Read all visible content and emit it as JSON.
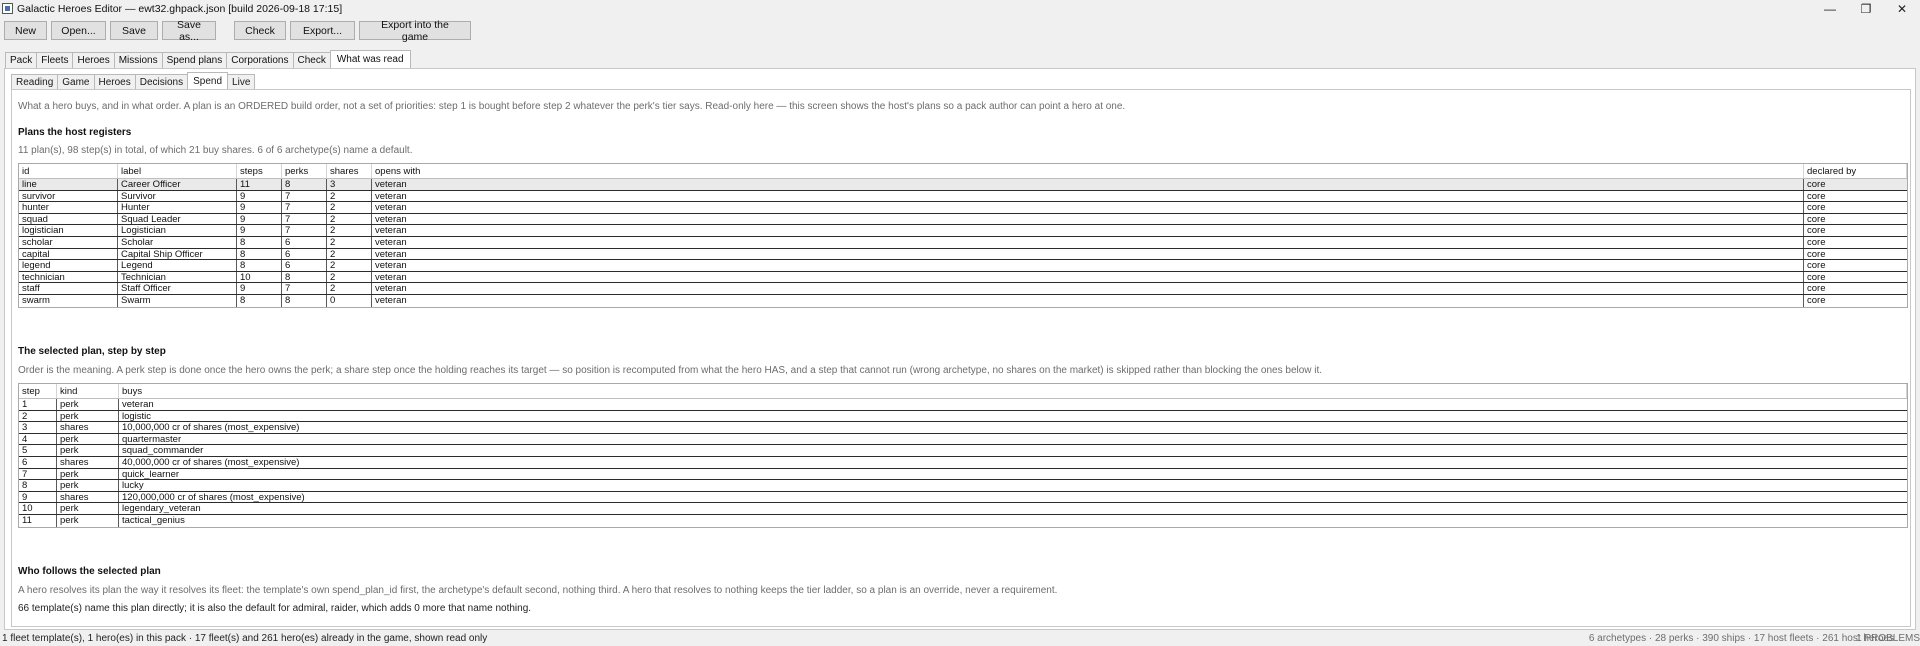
{
  "window": {
    "title": "Galactic Heroes Editor — ewt32.ghpack.json   [build 2026-09-18 17:15]",
    "minimize": "—",
    "maximize": "❐",
    "close": "✕"
  },
  "toolbar": {
    "new": "New",
    "open": "Open...",
    "save": "Save",
    "save_as": "Save as...",
    "check": "Check",
    "export": "Export...",
    "export_game": "Export into the game"
  },
  "tabs": [
    "Pack",
    "Fleets",
    "Heroes",
    "Missions",
    "Spend plans",
    "Corporations",
    "Check",
    "What was read"
  ],
  "active_tab": "What was read",
  "subtabs": [
    "Reading",
    "Game",
    "Heroes",
    "Decisions",
    "Spend",
    "Live"
  ],
  "active_subtab": "Spend",
  "spend": {
    "intro": "What a hero buys, and in what order. A plan is an ORDERED build order, not a set of priorities: step 1 is bought before step 2 whatever the perk's tier says. Read-only here — this screen shows the host's plans so a pack author can point a hero at one.",
    "plans_heading": "Plans the host registers",
    "plans_summary": "11 plan(s), 98 step(s) in total, of which 21 buy shares. 6 of 6 archetype(s) name a default.",
    "plans_columns": [
      "id",
      "label",
      "steps",
      "perks",
      "shares",
      "opens with",
      "declared by"
    ],
    "plans": [
      [
        "line",
        "Career Officer",
        "11",
        "8",
        "3",
        "veteran",
        "core"
      ],
      [
        "survivor",
        "Survivor",
        "9",
        "7",
        "2",
        "veteran",
        "core"
      ],
      [
        "hunter",
        "Hunter",
        "9",
        "7",
        "2",
        "veteran",
        "core"
      ],
      [
        "squad",
        "Squad Leader",
        "9",
        "7",
        "2",
        "veteran",
        "core"
      ],
      [
        "logistician",
        "Logistician",
        "9",
        "7",
        "2",
        "veteran",
        "core"
      ],
      [
        "scholar",
        "Scholar",
        "8",
        "6",
        "2",
        "veteran",
        "core"
      ],
      [
        "capital",
        "Capital Ship Officer",
        "8",
        "6",
        "2",
        "veteran",
        "core"
      ],
      [
        "legend",
        "Legend",
        "8",
        "6",
        "2",
        "veteran",
        "core"
      ],
      [
        "technician",
        "Technician",
        "10",
        "8",
        "2",
        "veteran",
        "core"
      ],
      [
        "staff",
        "Staff Officer",
        "9",
        "7",
        "2",
        "veteran",
        "core"
      ],
      [
        "swarm",
        "Swarm",
        "8",
        "8",
        "0",
        "veteran",
        "core"
      ]
    ],
    "steps_heading": "The selected plan, step by step",
    "steps_note": "Order is the meaning. A perk step is done once the hero owns the perk; a share step once the holding reaches its target — so position is recomputed from what the hero HAS, and a step that cannot run (wrong archetype, no shares on the market) is skipped rather than blocking the ones below it.",
    "steps_columns": [
      "step",
      "kind",
      "buys"
    ],
    "steps": [
      [
        "1",
        "perk",
        "veteran"
      ],
      [
        "2",
        "perk",
        "logistic"
      ],
      [
        "3",
        "shares",
        "10,000,000 cr of shares (most_expensive)"
      ],
      [
        "4",
        "perk",
        "quartermaster"
      ],
      [
        "5",
        "perk",
        "squad_commander"
      ],
      [
        "6",
        "shares",
        "40,000,000 cr of shares (most_expensive)"
      ],
      [
        "7",
        "perk",
        "quick_learner"
      ],
      [
        "8",
        "perk",
        "lucky"
      ],
      [
        "9",
        "shares",
        "120,000,000 cr of shares (most_expensive)"
      ],
      [
        "10",
        "perk",
        "legendary_veteran"
      ],
      [
        "11",
        "perk",
        "tactical_genius"
      ]
    ],
    "follows_heading": "Who follows the selected plan",
    "follows_note": "A hero resolves its plan the way it resolves its fleet: the template's own spend_plan_id first, the archetype's default second, nothing third. A hero that resolves to nothing keeps the tier ladder, so a plan is an override, never a requirement.",
    "follows_detail": "66 template(s) name this plan directly; it is also the default for admiral, raider, which adds 0 more that name nothing."
  },
  "status": {
    "left": "1 fleet template(s), 1 hero(es) in this pack · 17 fleet(s) and 261 hero(es) already in the game, shown read only",
    "right": "6 archetypes · 28 perks · 390 ships · 17 host fleets · 261 host heroes",
    "problems": "1 PROBLEMS"
  }
}
